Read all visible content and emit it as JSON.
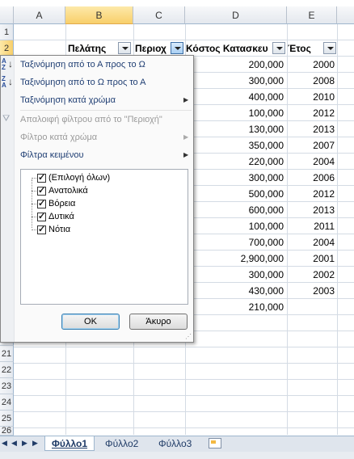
{
  "columns": [
    "A",
    "B",
    "C",
    "D",
    "E"
  ],
  "row_numbers": [
    "1",
    "2",
    "21",
    "22",
    "23",
    "24",
    "25",
    "26"
  ],
  "headers": {
    "b": "Πελάτης",
    "c": "Περιοχ",
    "d": "Κόστος Κατασκευ",
    "e": "Έτος"
  },
  "data_rows": [
    {
      "cost": "200,000",
      "year": "2000"
    },
    {
      "cost": "300,000",
      "year": "2008"
    },
    {
      "cost": "400,000",
      "year": "2010"
    },
    {
      "cost": "100,000",
      "year": "2012"
    },
    {
      "cost": "130,000",
      "year": "2013"
    },
    {
      "cost": "350,000",
      "year": "2007"
    },
    {
      "cost": "220,000",
      "year": "2004"
    },
    {
      "cost": "300,000",
      "year": "2006"
    },
    {
      "cost": "500,000",
      "year": "2012"
    },
    {
      "cost": "600,000",
      "year": "2013"
    },
    {
      "cost": "100,000",
      "year": "2011"
    },
    {
      "cost": "700,000",
      "year": "2004"
    },
    {
      "cost": "2,900,000",
      "year": "2001"
    },
    {
      "cost": "300,000",
      "year": "2002"
    },
    {
      "cost": "430,000",
      "year": "2003"
    },
    {
      "cost": "210,000",
      "year": ""
    }
  ],
  "filter_menu": {
    "sort_az": "Ταξινόμηση από το Α προς το Ω",
    "sort_za": "Ταξινόμηση από το Ω προς το Α",
    "sort_color": "Ταξινόμηση κατά χρώμα",
    "clear_filter": "Απαλοιφή φίλτρου από το \"Περιοχή\"",
    "filter_color": "Φίλτρο κατά χρώμα",
    "text_filters": "Φίλτρα κειμένου",
    "items": [
      "(Επιλογή όλων)",
      "Ανατολικά",
      "Βόρεια",
      "Δυτικά",
      "Νότια"
    ],
    "ok": "OK",
    "cancel": "Άκυρο"
  },
  "sheet_tabs": [
    "Φύλλο1",
    "Φύλλο2",
    "Φύλλο3"
  ],
  "accent": "#f8cf6a"
}
